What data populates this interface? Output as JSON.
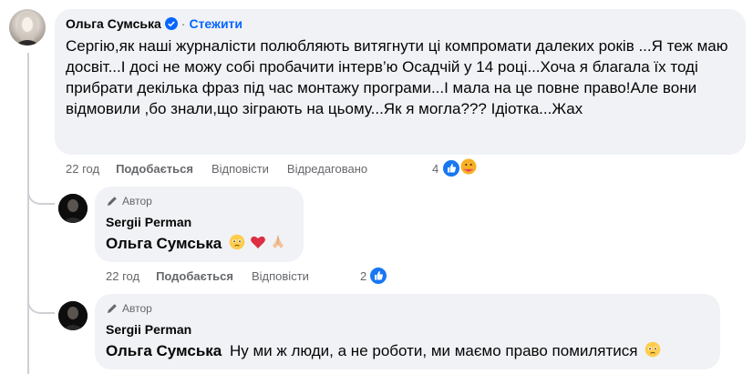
{
  "top_comment": {
    "author": "Ольга Сумська",
    "verified": true,
    "follow_label": "Стежити",
    "text": "Сергію,як наші журналісти полюбляють витягнути ці компромати далеких років ...Я теж маю досвіт...І досі не можу собі пробачити інтерв’ю Осадчій у 14 році...Хоча я благала їх тоді прибрати декілька фраз під час монтажу програми...І мала на це повне право!Але вони відмовили ,бо знали,що зіграють на цьому...Як я могла??? Ідіотка...Жах",
    "time": "22 год",
    "like_label": "Подобається",
    "reply_label": "Відповісти",
    "edited_label": "Відредаговано",
    "reaction_count": "4"
  },
  "reply_1": {
    "badge": "Автор",
    "author": "Sergii Perman",
    "mention": "Ольга Сумська",
    "text": "",
    "time": "22 год",
    "like_label": "Подобається",
    "reply_label": "Відповісти",
    "reaction_count": "2"
  },
  "reply_2": {
    "badge": "Автор",
    "author": "Sergii Perman",
    "mention": "Ольга Сумська",
    "text": "Ну ми ж люди, а не роботи, ми маємо право помилятися"
  },
  "colors": {
    "bubble": "#f0f2f5",
    "link_blue": "#0866ff",
    "meta_gray": "#65676b",
    "like_blue": "#1877f2"
  },
  "icons": [
    "verified-badge-icon",
    "pencil-icon",
    "like-reaction-icon",
    "care-reaction-icon",
    "teary-face-emoji",
    "red-heart-emoji",
    "folded-hands-emoji"
  ]
}
